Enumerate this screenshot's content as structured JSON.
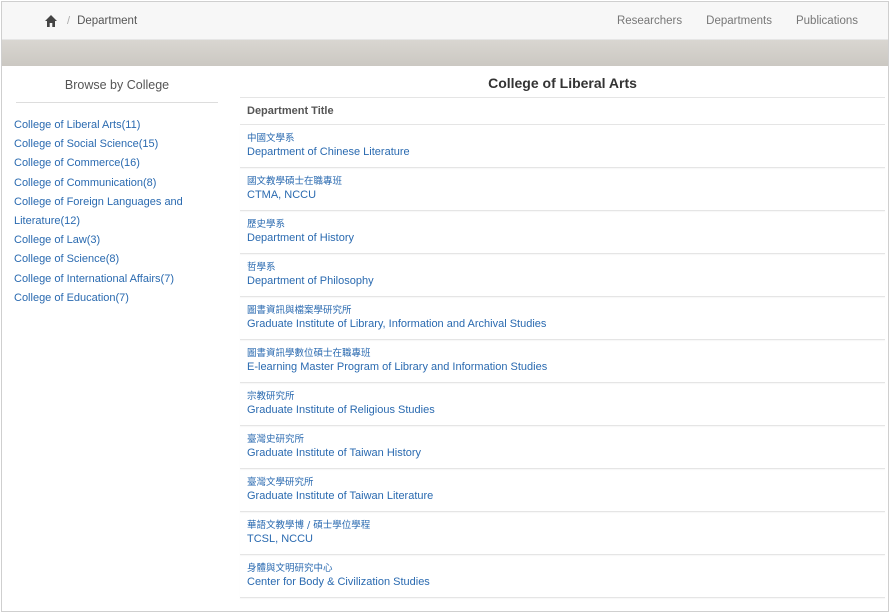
{
  "breadcrumb": {
    "current": "Department"
  },
  "nav": {
    "researchers": "Researchers",
    "departments": "Departments",
    "publications": "Publications"
  },
  "sidebar": {
    "title": "Browse by College",
    "colleges": [
      "College of Liberal Arts(11)",
      "College of Social Science(15)",
      "College of Commerce(16)",
      "College of Communication(8)",
      "College of Foreign Languages and",
      "Literature(12)",
      "College of Law(3)",
      "College of Science(8)",
      "College of International Affairs(7)",
      "College of Education(7)"
    ]
  },
  "main": {
    "title": "College of Liberal Arts",
    "column_header": "Department Title",
    "departments": [
      {
        "zh": "中國文學系",
        "en": "Department of Chinese Literature"
      },
      {
        "zh": "國文教學碩士在職專班",
        "en": "CTMA, NCCU"
      },
      {
        "zh": "歷史學系",
        "en": "Department of History"
      },
      {
        "zh": "哲學系",
        "en": "Department of Philosophy"
      },
      {
        "zh": "圖書資訊與檔案學研究所",
        "en": "Graduate Institute of Library, Information and Archival Studies"
      },
      {
        "zh": "圖書資訊學數位碩士在職專班",
        "en": "E-learning Master Program of Library and Information Studies"
      },
      {
        "zh": "宗教研究所",
        "en": "Graduate Institute of Religious Studies"
      },
      {
        "zh": "臺灣史研究所",
        "en": "Graduate Institute of Taiwan History"
      },
      {
        "zh": "臺灣文學研究所",
        "en": "Graduate Institute of Taiwan Literature"
      },
      {
        "zh": "華語文教學博 / 碩士學位學程",
        "en": "TCSL, NCCU"
      },
      {
        "zh": "身體與文明研究中心",
        "en": "Center for Body & Civilization Studies"
      }
    ]
  },
  "icons": {
    "home": "home-icon"
  },
  "colors": {
    "link": "#2a6ab0",
    "banner": "#cbc8c2"
  }
}
